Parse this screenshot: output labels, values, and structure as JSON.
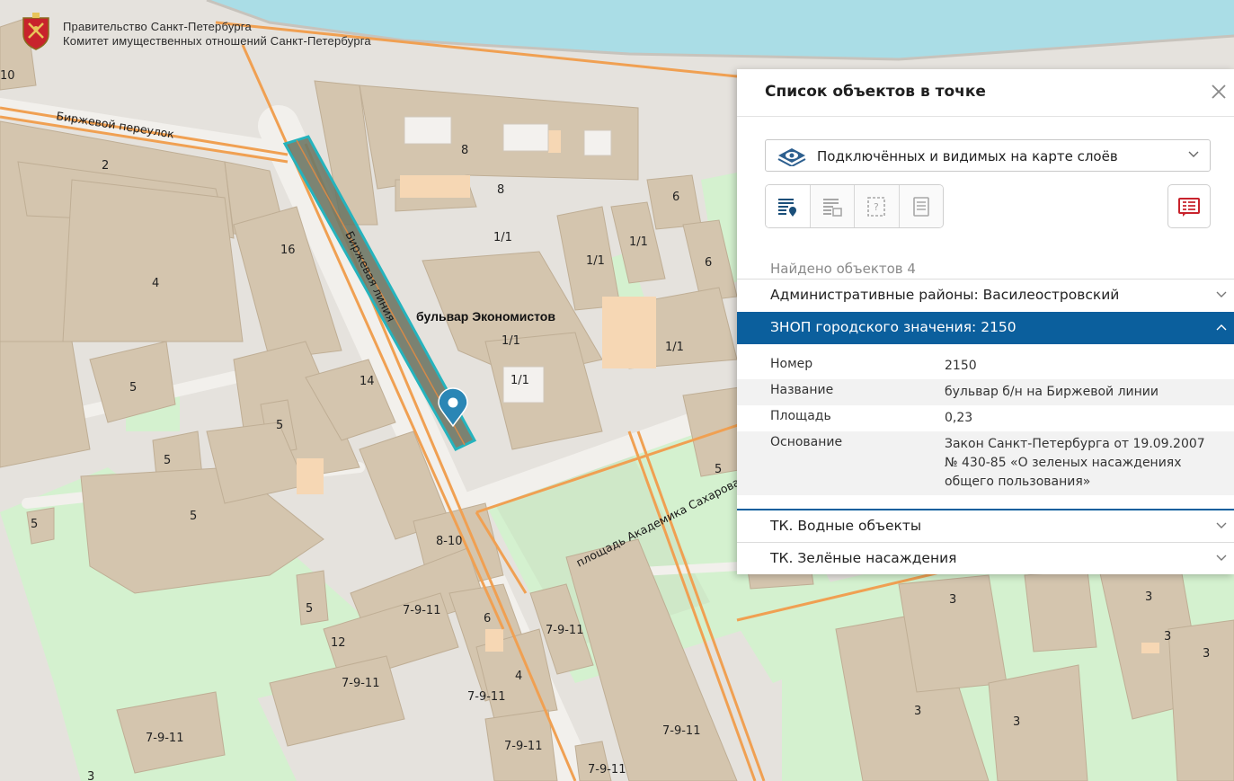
{
  "header": {
    "line1": "Правительство Санкт-Петербурга",
    "line2": "Комитет имущественных отношений Санкт-Петербурга"
  },
  "map": {
    "street_labels": {
      "birzhevoy_pereulok": "Биржевой переулок",
      "birzhevaya_liniya": "Биржевая линия",
      "ploshchad_sakharova": "площадь Академика Сахарова",
      "bulvar_ekonomistov": "бульвар Экономистов"
    },
    "building_numbers": {
      "n10": "10",
      "n2": "2",
      "n8a": "8",
      "n8b": "8",
      "n16": "16",
      "n4a": "4",
      "n11a": "1/1",
      "n11b": "1/1",
      "n11c": "1/1",
      "n11d": "1/1",
      "n11e": "1/1",
      "n11f": "1/1",
      "n6a": "6",
      "n6b": "6",
      "n5a": "5",
      "n5b": "5",
      "n5c": "5",
      "n5d": "5",
      "n5e": "5",
      "n5f": "5",
      "n5g": "5",
      "n14": "14",
      "n810": "8-10",
      "n7911a": "7-9-11",
      "n7911b": "7-9-11",
      "n7911c": "7-9-11",
      "n7911d": "7-9-11",
      "n7911e": "7-9-11",
      "n7911f": "7-9-11",
      "n7911g": "7-9-11",
      "n7911h": "7-9-11",
      "n7911i": "7-9-11",
      "n6c": "6",
      "n4b": "4",
      "n12": "12",
      "n3a": "3",
      "n3b": "3",
      "n3c": "3",
      "n3d": "3",
      "n3e": "3",
      "n3f": "3",
      "n3g": "3"
    }
  },
  "panel": {
    "title": "Список объектов в точке",
    "layer_select": "Подключённых и видимых на карте слоёв",
    "found": "Найдено объектов 4",
    "sections": [
      {
        "label": "Административные районы: Василеостровский",
        "expanded": false
      },
      {
        "label": "ЗНОП городского значения: 2150",
        "expanded": true
      },
      {
        "label": "ТК. Водные объекты",
        "expanded": false
      },
      {
        "label": "ТК. Зелёные насаждения",
        "expanded": false
      }
    ],
    "properties": [
      {
        "key": "Номер",
        "value": "2150"
      },
      {
        "key": "Название",
        "value": "бульвар б/н на Биржевой линии"
      },
      {
        "key": "Площадь",
        "value": "0,23"
      },
      {
        "key": "Основание",
        "value": "Закон Санкт-Петербурга от 19.09.2007 № 430-85 «О зеленых насаждениях общего пользования»"
      }
    ]
  },
  "colors": {
    "accent": "#0b5f9d",
    "selection_fill": "#6f7866",
    "selection_outline": "#25b3bd",
    "building": "#d3c3ab",
    "green": "#d2f2d0",
    "water": "#aadde6",
    "road_orange": "#f2a24c"
  }
}
